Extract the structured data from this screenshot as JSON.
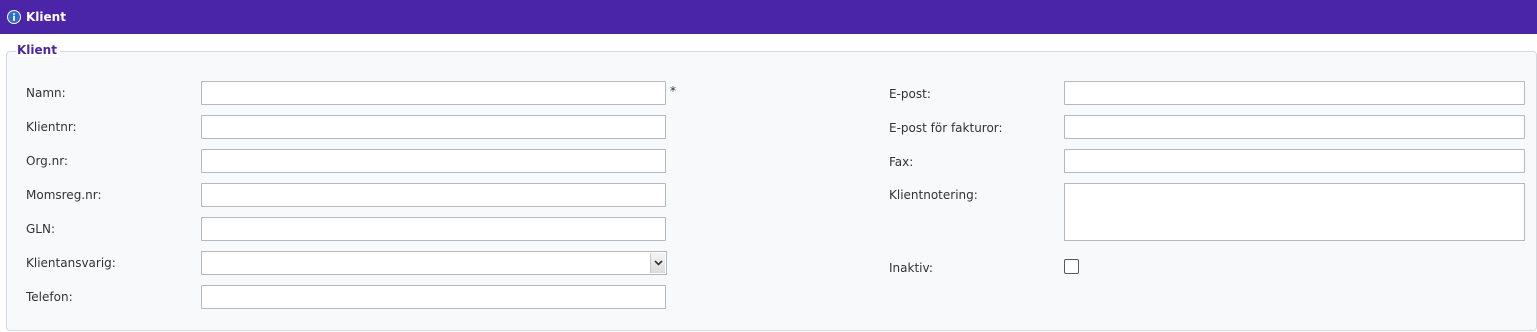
{
  "header": {
    "title": "Klient",
    "icon": "info-icon"
  },
  "form": {
    "legend": "Klient",
    "required_marker": "*",
    "left": {
      "namn": {
        "label": "Namn:",
        "value": ""
      },
      "klientnr": {
        "label": "Klientnr:",
        "value": ""
      },
      "orgnr": {
        "label": "Org.nr:",
        "value": ""
      },
      "momsreg": {
        "label": "Momsreg.nr:",
        "value": ""
      },
      "gln": {
        "label": "GLN:",
        "value": ""
      },
      "klientansvarig": {
        "label": "Klientansvarig:",
        "selected": ""
      },
      "telefon": {
        "label": "Telefon:",
        "value": ""
      }
    },
    "right": {
      "epost": {
        "label": "E-post:",
        "value": ""
      },
      "epost_faktura": {
        "label": "E-post för fakturor:",
        "value": ""
      },
      "fax": {
        "label": "Fax:",
        "value": ""
      },
      "klientnotering": {
        "label": "Klientnotering:",
        "value": ""
      },
      "inaktiv": {
        "label": "Inaktiv:",
        "checked": false
      }
    }
  },
  "colors": {
    "header_bg": "#4b25a8",
    "legend_text": "#4b25a8"
  }
}
